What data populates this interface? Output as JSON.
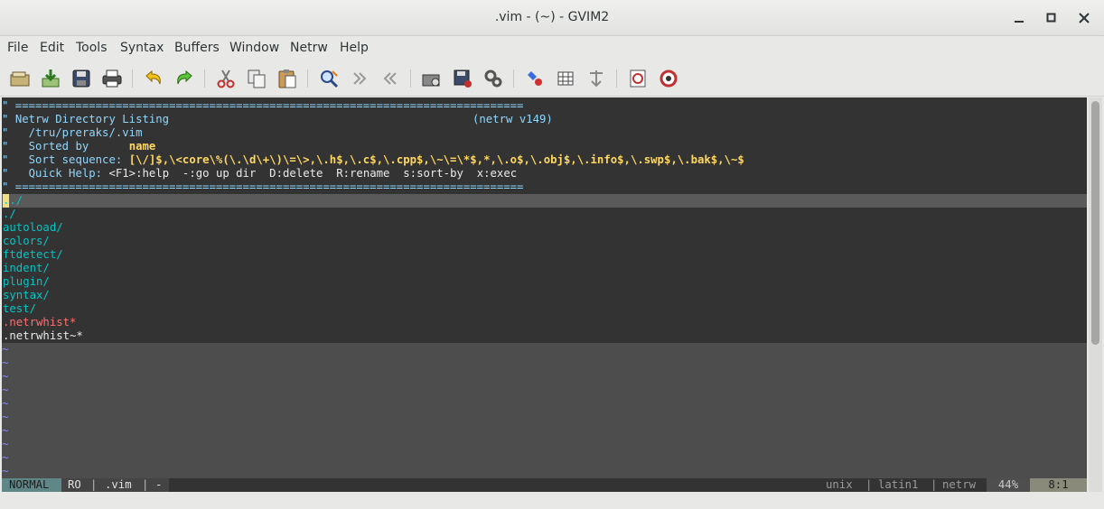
{
  "window": {
    "title": ".vim - (~) - GVIM2"
  },
  "menu": [
    "File",
    "Edit",
    "Tools",
    "Syntax",
    "Buffers",
    "Window",
    "Netrw",
    "Help"
  ],
  "toolbar_icons": [
    "open-icon",
    "save-session-icon",
    "save-icon",
    "print-icon",
    "undo-icon",
    "redo-icon",
    "cut-icon",
    "copy-icon",
    "paste-icon",
    "find-replace-icon",
    "find-next-icon",
    "find-prev-icon",
    "load-session-icon",
    "save-session-disk-icon",
    "run-script-icon",
    "make-icon",
    "table-icon",
    "jump-tag-icon",
    "help-icon",
    "find-help-icon"
  ],
  "editor": {
    "header": {
      "rule": "\" ============================================================================",
      "title": "Netrw Directory Listing",
      "version": "(netrw v149)",
      "path": "/tru/preraks/.vim",
      "sorted_by_label": "Sorted by",
      "sorted_by_value": "name",
      "sort_seq_label": "Sort sequence:",
      "sort_seq_value": "[\\/]$,\\<core\\%(\\.\\d\\+\\)\\=\\>,\\.h$,\\.c$,\\.cpp$,\\~\\=\\*$,*,\\.o$,\\.obj$,\\.info$,\\.swp$,\\.bak$,\\~$",
      "quick_help_label": "Quick Help:",
      "quick_help_items": [
        "<F1>:help",
        "-:go up dir",
        "D:delete",
        "R:rename",
        "s:sort-by",
        "x:exec"
      ]
    },
    "entries": [
      "../",
      "./",
      "autoload/",
      "colors/",
      "ftdetect/",
      "indent/",
      "plugin/",
      "syntax/",
      "test/",
      ".netrwhist*",
      ".netrwhist~*"
    ],
    "tilde_count": 10
  },
  "statusline": {
    "mode": "NORMAL",
    "flags": "RO",
    "filename": ".vim",
    "modified": "-",
    "fileformat": "unix",
    "encoding": "latin1",
    "filetype": "netrw",
    "percent": "44%",
    "position": "8:1"
  },
  "colors": {
    "mode_bg": "#5f8787",
    "pos_bg": "#8a8a7a",
    "header_blue": "#8fd7ff",
    "dir_cyan": "#00c5c5"
  }
}
